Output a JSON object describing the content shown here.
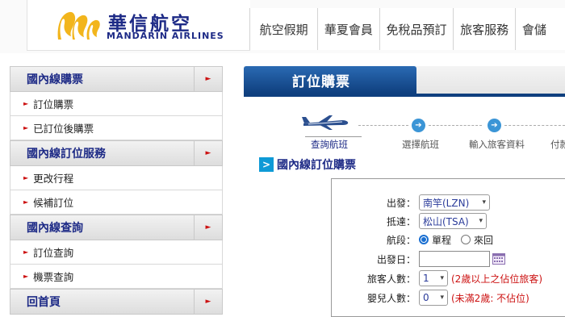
{
  "brand": {
    "name_zh": "華信航空",
    "name_en": "MANDARIN AIRLINES"
  },
  "top_nav": [
    "航空假期",
    "華夏會員",
    "免稅品預訂",
    "旅客服務",
    "會儲"
  ],
  "sidebar": {
    "sections": [
      {
        "title": "國內線購票",
        "items": [
          "訂位購票",
          "已訂位後購票"
        ]
      },
      {
        "title": "國內線訂位服務",
        "items": [
          "更改行程",
          "候補訂位"
        ]
      },
      {
        "title": "國內線查詢",
        "items": [
          "訂位查詢",
          "機票查詢"
        ]
      },
      {
        "title": "回首頁",
        "items": []
      }
    ]
  },
  "main": {
    "tab_title": "訂位購票",
    "steps": [
      "查詢航班",
      "選擇航班",
      "輸入旅客資料",
      "付款"
    ],
    "section_title": "國內線訂位購票",
    "form": {
      "departure_label": "出發：",
      "departure_value": "南竿(LZN)",
      "arrival_label": "抵達：",
      "arrival_value": "松山(TSA)",
      "trip_label": "航段：",
      "trip_options": [
        "單程",
        "來回"
      ],
      "trip_selected": "單程",
      "date_label": "出發日：",
      "date_value": "",
      "passengers_label": "旅客人數：",
      "passengers_value": "1",
      "passengers_note": "(2歲以上之佔位旅客)",
      "infants_label": "嬰兒人數：",
      "infants_value": "0",
      "infants_note": "(未滿2歲: 不佔位)"
    }
  },
  "colors": {
    "brand_navy": "#1d2a86",
    "tab_blue": "#0f3f7e",
    "step_blue": "#3b95d6",
    "note_red": "#cc1111",
    "logo_yellow": "#f2b51c"
  }
}
